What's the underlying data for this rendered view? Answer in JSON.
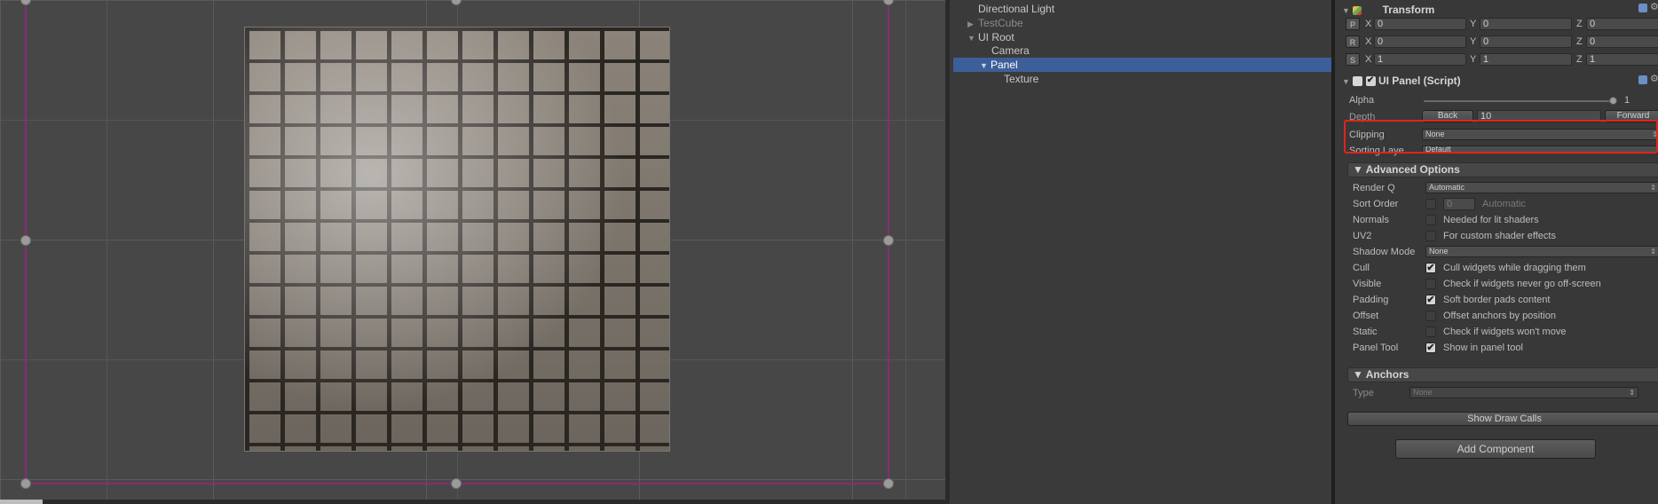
{
  "hierarchy": {
    "items": [
      {
        "label": "Directional Light",
        "indent": 0,
        "arrow": "",
        "dim": false
      },
      {
        "label": "TestCube",
        "indent": 0,
        "arrow": "▶",
        "dim": true
      },
      {
        "label": "UI Root",
        "indent": 0,
        "arrow": "▼",
        "dim": false
      },
      {
        "label": "Camera",
        "indent": 1,
        "arrow": "",
        "dim": false
      },
      {
        "label": "Panel",
        "indent": 1,
        "arrow": "▼",
        "dim": false,
        "selected": true
      },
      {
        "label": "Texture",
        "indent": 2,
        "arrow": "",
        "dim": false
      }
    ]
  },
  "transform": {
    "title": "Transform",
    "rows": [
      {
        "btn": "P",
        "x": "0",
        "y": "0",
        "z": "0"
      },
      {
        "btn": "R",
        "x": "0",
        "y": "0",
        "z": "0"
      },
      {
        "btn": "S",
        "x": "1",
        "y": "1",
        "z": "1"
      }
    ],
    "axis": {
      "x": "X",
      "y": "Y",
      "z": "Z"
    }
  },
  "ui_panel": {
    "title": "UI Panel (Script)",
    "alpha_label": "Alpha",
    "alpha_value": "1",
    "depth_label": "Depth",
    "back_label": "Back",
    "depth_value": "10",
    "forward_label": "Forward",
    "clipping_label": "Clipping",
    "clipping_value": "None",
    "sorting_label": "Sorting Laye",
    "sorting_value": "Default"
  },
  "advanced": {
    "title": "▼ Advanced Options",
    "render_q_label": "Render Q",
    "render_q_value": "Automatic",
    "sort_order_label": "Sort Order",
    "sort_order_value": "0",
    "sort_order_hint": "Automatic",
    "shadow_label": "Shadow Mode",
    "shadow_value": "None",
    "toggles": [
      {
        "label": "Normals",
        "text": "Needed for lit shaders",
        "checked": false
      },
      {
        "label": "UV2",
        "text": "For custom shader effects",
        "checked": false
      },
      {
        "label": "Cull",
        "text": "Cull widgets while dragging them",
        "checked": true
      },
      {
        "label": "Visible",
        "text": "Check if widgets never go off-screen",
        "checked": false
      },
      {
        "label": "Padding",
        "text": "Soft border pads content",
        "checked": true
      },
      {
        "label": "Offset",
        "text": "Offset anchors by position",
        "checked": false
      },
      {
        "label": "Static",
        "text": "Check if widgets won't move",
        "checked": false
      },
      {
        "label": "Panel Tool",
        "text": "Show in panel tool",
        "checked": true
      }
    ]
  },
  "anchors": {
    "title": "▼ Anchors",
    "type_label": "Type",
    "type_value": "None"
  },
  "buttons": {
    "show_draw_calls": "Show Draw Calls",
    "add_component": "Add Component"
  },
  "colors": {
    "selection": "#3d5f99",
    "highlight": "#e0241f",
    "panel_outline": "#8a2a78"
  }
}
